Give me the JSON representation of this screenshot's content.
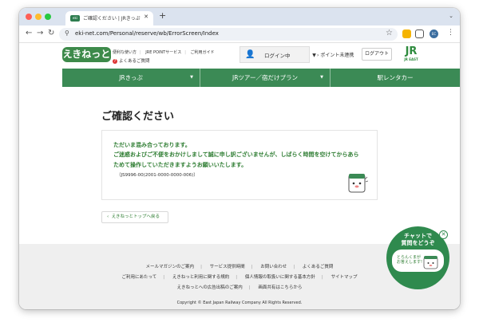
{
  "browser": {
    "tab_title": "ご確認ください | JRきっぷ・えき",
    "tab_favicon_text": "eki",
    "url": "eki-net.com/Personal/reserve/wb/ErrorScreen/Index",
    "avatar_text": "EC"
  },
  "site": {
    "logo": "えきねっと",
    "header_links": [
      "便利な使い方",
      "JRE POINTサービス",
      "ご利用ガイド"
    ],
    "faq_link": "よくあるご質問",
    "login_status": "ログイン中",
    "points_label": "ポイント未連携",
    "logout_label": "ログアウト",
    "jr_logo": "JR",
    "jr_logo_sub": "JR EAST"
  },
  "nav": {
    "items": [
      "JRきっぷ",
      "JRツアー／宿だけプラン",
      "駅レンタカー"
    ]
  },
  "main": {
    "title": "ご確認ください",
    "message_line1": "ただいま混み合っております。",
    "message_line2": "ご迷惑およびご不便をおかけしまして誠に申し訳ございませんが、しばらく時間を空けてからあら",
    "message_line3": "ためて操作していただきますようお願いいたします。",
    "error_code": "（JS9996-00(2001-0000-0000-006)）",
    "back_button": "えきねっとトップへ戻る"
  },
  "footer": {
    "row1": [
      "メールマガジンのご案内",
      "サービス提供時間",
      "お問い合わせ",
      "よくあるご質問"
    ],
    "row2": [
      "ご利用にあたって",
      "えきねっと利用に関する規約",
      "個人情報の取扱いに関する基本方針",
      "サイトマップ"
    ],
    "row3": [
      "えきねっとへの広告出稿のご案内",
      "画面共有はこちらから"
    ],
    "copyright": "Copyright © East Japan Railway Company All Rights Reserved."
  },
  "chat": {
    "title_line1": "チャットで",
    "title_line2": "質問をどうぞ",
    "bubble_line1": "とらんくまが",
    "bubble_line2": "お答えします!"
  },
  "colors": {
    "brand_green": "#3b8a55",
    "message_green": "#2e7d32"
  }
}
